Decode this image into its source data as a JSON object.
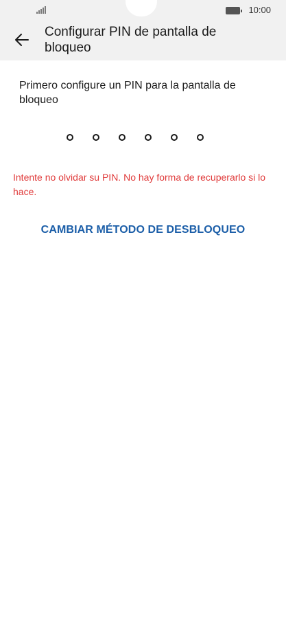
{
  "status_bar": {
    "time": "10:00",
    "signal_icon": "signal-icon",
    "battery_icon": "battery-icon"
  },
  "header": {
    "back_icon": "arrow-left-icon",
    "title": "Configurar PIN de pantalla de bloqueo"
  },
  "main": {
    "instruction": "Primero configure un PIN para la pantalla de bloqueo",
    "pin_length": 6,
    "pin_filled": 0,
    "warning": "Intente no olvidar su PIN. No hay forma de recuperarlo si lo hace.",
    "change_method_label": "CAMBIAR MÉTODO DE DESBLOQUEO"
  },
  "colors": {
    "header_bg": "#f1f1f1",
    "warning": "#e03a3a",
    "link": "#1b5ea8",
    "text": "#1a1a1a"
  }
}
